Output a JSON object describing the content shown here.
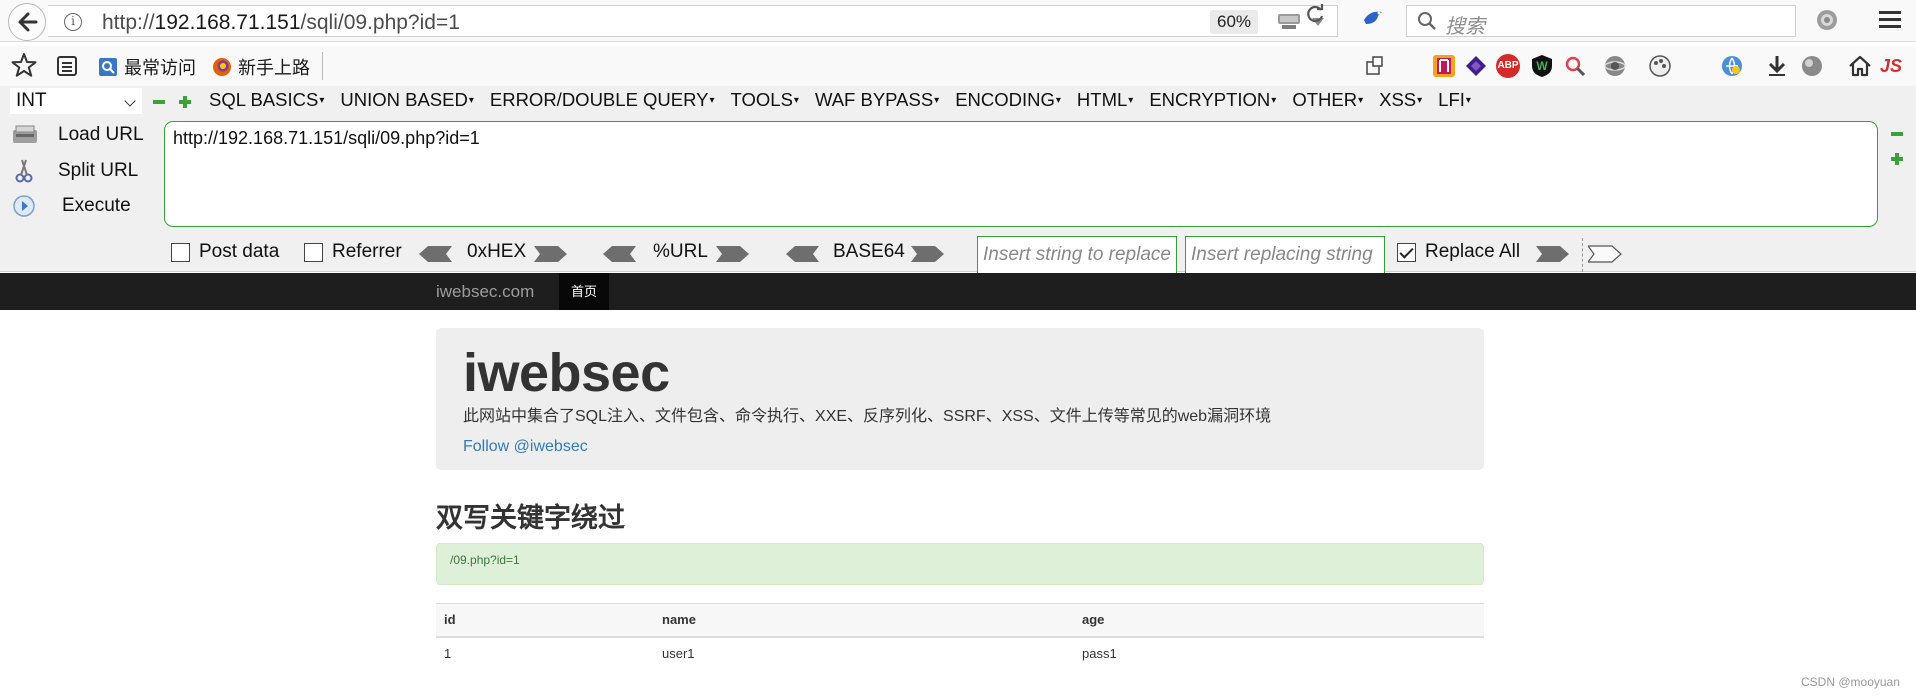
{
  "browser": {
    "url_prefix": "http://",
    "url_host": "192.168.71.151",
    "url_path": "/sqli/09.php?id=1",
    "zoom": "60%",
    "search_placeholder": "搜索"
  },
  "bookmarks": {
    "items": [
      {
        "label": "最常访问"
      },
      {
        "label": "新手上路"
      }
    ]
  },
  "extensions": {
    "abp_label": "ABP",
    "js_label": "JS"
  },
  "hackbar": {
    "encoding_select": "INT",
    "menus": [
      "SQL BASICS",
      "UNION BASED",
      "ERROR/DOUBLE QUERY",
      "TOOLS",
      "WAF BYPASS",
      "ENCODING",
      "HTML",
      "ENCRYPTION",
      "OTHER",
      "XSS",
      "LFI"
    ],
    "load_url": "Load URL",
    "split_url": "Split URL",
    "execute": "Execute",
    "url_value": "http://192.168.71.151/sqli/09.php?id=1",
    "post_data": "Post data",
    "referrer": "Referrer",
    "hex": "0xHEX",
    "url_enc": "%URL",
    "base64": "BASE64",
    "replace_placeholder": "Insert string to replace",
    "replacing_placeholder": "Insert replacing string",
    "replace_all": "Replace All",
    "post_data_checked": false,
    "referrer_checked": false,
    "replace_all_checked": true
  },
  "site": {
    "brand": "iwebsec.com",
    "home_tab": "首页",
    "title": "iwebsec",
    "description": "此网站中集合了SQL注入、文件包含、命令执行、XXE、反序列化、SSRF、XSS、文件上传等常见的web漏洞环境",
    "follow": "Follow @iwebsec",
    "section_title": "双写关键字绕过",
    "alert": "/09.php?id=1",
    "table": {
      "headers": [
        "id",
        "name",
        "age"
      ],
      "rows": [
        [
          "1",
          "user1",
          "pass1"
        ]
      ]
    }
  },
  "watermark": "CSDN @mooyuan",
  "colors": {
    "hackbar_green": "#35a035",
    "navbar_dark": "#1e1e1e",
    "link_blue": "#337ab7",
    "alert_bg": "#dff0d8"
  }
}
